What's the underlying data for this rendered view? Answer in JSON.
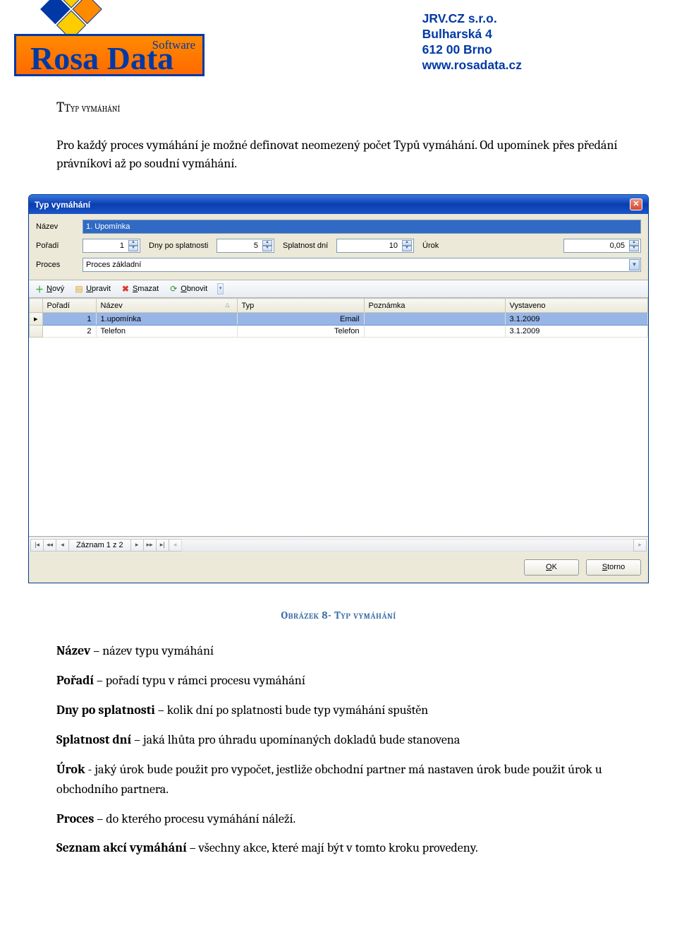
{
  "company": {
    "name": "JRV.CZ s.r.o.",
    "street": "Bulharská 4",
    "city": "612 00 Brno",
    "web": "www.rosadata.cz"
  },
  "logo": {
    "main": "Rosa Data",
    "tag": "Software",
    "reg": "®"
  },
  "heading": "Typ vymáhání",
  "intro": "Pro každý proces vymáhání je možné definovat neomezený počet Typů vymáhání. Od upomínek přes předání právníkovi až po soudní vymáhání.",
  "dialog": {
    "title": "Typ vymáhání",
    "labels": {
      "nazev": "Název",
      "poradi": "Pořadí",
      "dny": "Dny po splatnosti",
      "splatnost": "Splatnost dní",
      "urok": "Úrok",
      "proces": "Proces"
    },
    "values": {
      "nazev": "1. Upomínka",
      "poradi": "1",
      "dny": "5",
      "splatnost": "10",
      "urok": "0,05",
      "proces": "Proces základní"
    },
    "toolbar": {
      "novy": "Nový",
      "upravit": "Upravit",
      "smazat": "Smazat",
      "obnovit": "Obnovit"
    },
    "grid": {
      "headers": {
        "poradi": "Pořadí",
        "nazev": "Název",
        "typ": "Typ",
        "poznamka": "Poznámka",
        "vystaveno": "Vystaveno"
      },
      "rows": [
        {
          "poradi": "1",
          "nazev": "1.upomínka",
          "typ": "Email",
          "poznamka": "",
          "vystaveno": "3.1.2009",
          "selected": true
        },
        {
          "poradi": "2",
          "nazev": "Telefon",
          "typ": "Telefon",
          "poznamka": "",
          "vystaveno": "3.1.2009",
          "selected": false
        }
      ]
    },
    "nav_record": "Záznam 1 z 2",
    "buttons": {
      "ok": "OK",
      "storno": "Storno"
    }
  },
  "caption": "Obrázek 8- Typ vymáhání",
  "defs": {
    "d1_label": "Název",
    "d1_text": " – název typu vymáhání",
    "d2_label": "Pořadí",
    "d2_text": " – pořadí typu v rámci procesu vymáhání",
    "d3_label": "Dny po splatnosti",
    "d3_text": " – kolik dní po splatnosti bude typ vymáhání spuštěn",
    "d4_label": "Splatnost dní",
    "d4_text": " – jaká lhůta pro úhradu upomínaných dokladů bude stanovena",
    "d5_label": "Úrok",
    "d5_text": " -  jaký úrok bude použit pro vypočet, jestliže obchodní partner má nastaven úrok bude použit úrok u obchodního partnera.",
    "d6_label": "Proces",
    "d6_text": " – do kterého procesu vymáhání náleží.",
    "d7_label": "Seznam akcí vymáhání",
    "d7_text": " – všechny akce, které mají být v tomto kroku provedeny."
  }
}
